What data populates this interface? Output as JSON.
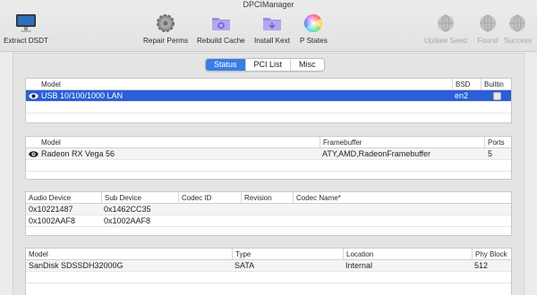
{
  "window": {
    "title": "DPCIManager"
  },
  "toolbar": {
    "extract_dsdt": "Extract DSDT",
    "repair_perms": "Repair Perms",
    "rebuild_cache": "Rebuild Cache",
    "install_kext": "Install Kext",
    "p_states": "P States",
    "update_seed": "Update Seed",
    "found": "Found",
    "success": "Success"
  },
  "tabs": [
    "Status",
    "PCI List",
    "Misc"
  ],
  "network": {
    "headers": [
      "Model",
      "BSD",
      "Builtin"
    ],
    "rows": [
      {
        "model": "USB 10/100/1000 LAN",
        "bsd": "en2"
      }
    ]
  },
  "graphics": {
    "headers": [
      "Model",
      "Framebuffer",
      "Ports"
    ],
    "rows": [
      {
        "model": "Radeon RX Vega 56",
        "framebuffer": "ATY,AMD,RadeonFramebuffer",
        "ports": "5"
      }
    ]
  },
  "audio": {
    "headers": [
      "Audio Device",
      "Sub Device",
      "Codec ID",
      "Revision",
      "Codec Name*"
    ],
    "rows": [
      {
        "device": "0x10221487",
        "sub": "0x1462CC35"
      },
      {
        "device": "0x1002AAF8",
        "sub": "0x1002AAF8"
      }
    ]
  },
  "storage": {
    "headers": [
      "Model",
      "Type",
      "Location",
      "Phy Block"
    ],
    "rows": [
      {
        "model": "SanDisk SDSSDH32000G",
        "type": "SATA",
        "location": "Internal",
        "phy_block": "512"
      }
    ]
  },
  "colors": {
    "selection": "#2b5fd8",
    "tab_active": "#3a7de6"
  }
}
